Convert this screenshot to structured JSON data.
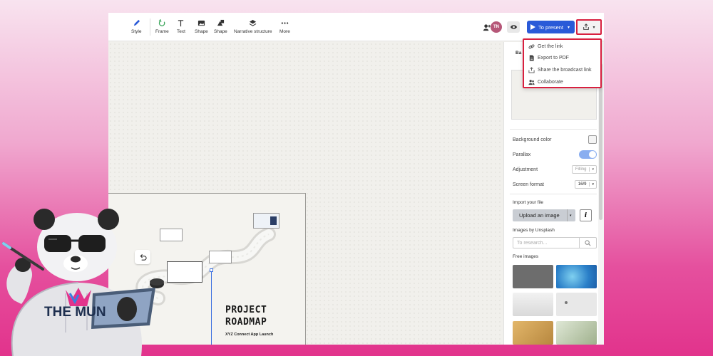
{
  "toolbar": {
    "tools": [
      {
        "label": "Style",
        "icon": "pen-icon"
      },
      {
        "label": "Frame",
        "icon": "frame-icon"
      },
      {
        "label": "Text",
        "icon": "text-icon"
      },
      {
        "label": "Shape",
        "icon": "image-icon"
      },
      {
        "label": "Shape",
        "icon": "shapes-icon"
      },
      {
        "label": "Narrative structure",
        "icon": "layers-icon"
      },
      {
        "label": "More",
        "icon": "more-icon"
      }
    ],
    "avatar_initials": "TN",
    "present_label": "To present"
  },
  "share_menu": {
    "items": [
      {
        "label": "Get the link",
        "icon": "link-icon"
      },
      {
        "label": "Export to PDF",
        "icon": "pdf-icon"
      },
      {
        "label": "Share the broadcast link",
        "icon": "broadcast-icon"
      },
      {
        "label": "Collaborate",
        "icon": "users-icon"
      }
    ]
  },
  "canvas": {
    "title_line1": "PROJECT",
    "title_line2": "ROADMAP",
    "subtitle": "XYZ Connect App Launch"
  },
  "panel": {
    "tab_label": "Ba",
    "background_color_label": "Background color",
    "parallax_label": "Parallax",
    "parallax_on": true,
    "adjustment_label": "Adjustment",
    "adjustment_value": "Filling",
    "screen_format_label": "Screen format",
    "screen_format_value": "16/9",
    "import_label": "Import your file",
    "upload_label": "Upload an image",
    "info_label": "i",
    "unsplash_label": "Images by Unsplash",
    "search_placeholder": "To research...",
    "free_images_label": "Free images"
  },
  "branding": {
    "logo_text": "THE MUN"
  },
  "colors": {
    "accent": "#2a5ad8",
    "highlight": "#d8203f",
    "avatar": "#b65778"
  }
}
